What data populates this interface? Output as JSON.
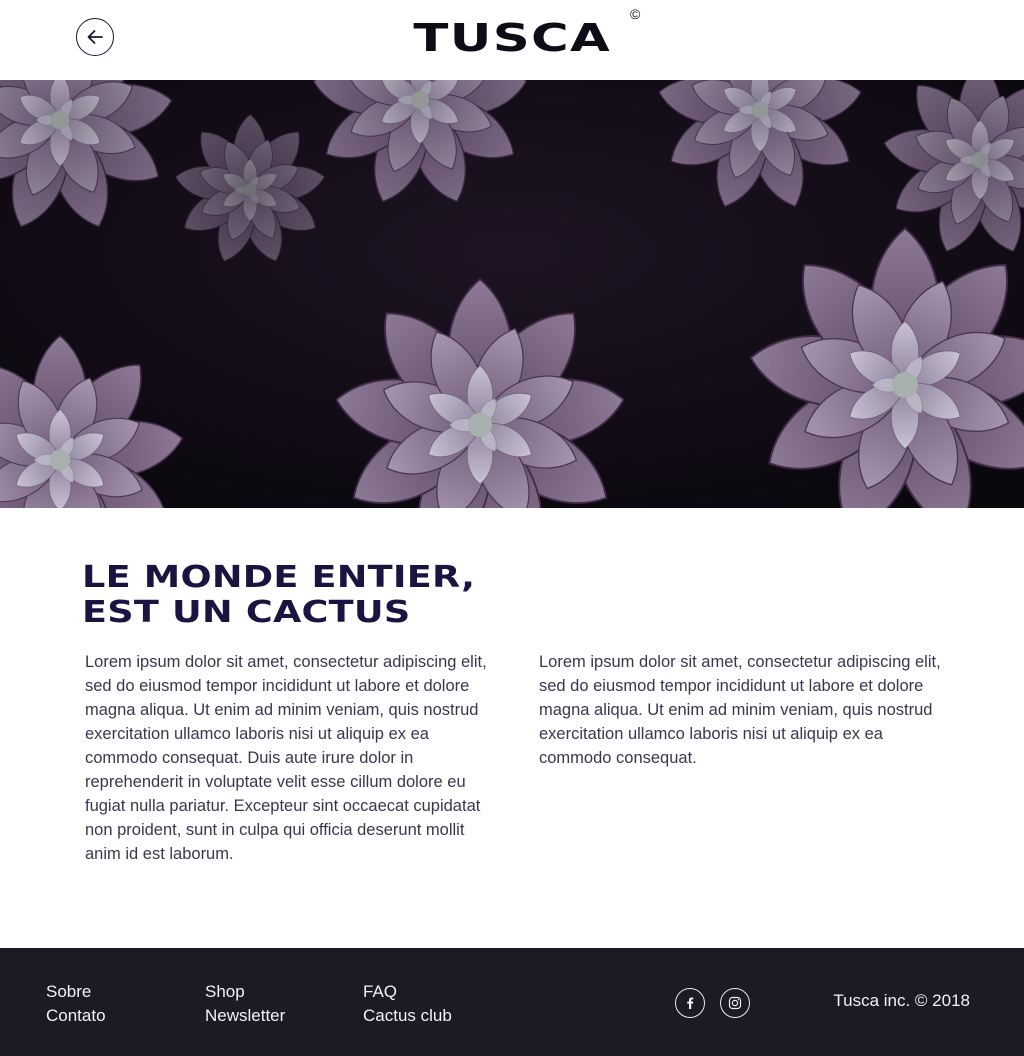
{
  "header": {
    "logo_text": "TUSCA",
    "logo_mark": "©",
    "back_icon": "arrow-left-icon"
  },
  "hero": {
    "image": "purple succulent plants"
  },
  "main": {
    "headline_line1": "LE MONDE ENTIER,",
    "headline_line2": "EST UN CACTUS",
    "paragraph_left": "Lorem ipsum dolor sit amet, consectetur adipiscing elit, sed do eiusmod tempor incididunt ut labore et dolore magna aliqua. Ut enim ad minim veniam, quis nostrud exercitation ullamco laboris nisi ut aliquip ex ea commodo consequat. Duis aute irure dolor in reprehenderit in voluptate velit esse cillum dolore eu fugiat nulla pariatur. Excepteur sint occaecat cupidatat non proident, sunt in culpa qui officia deserunt mollit anim id est laborum.",
    "paragraph_right": "Lorem ipsum dolor sit amet, consectetur adipiscing elit, sed do eiusmod tempor incididunt ut labore et dolore magna aliqua. Ut enim ad minim veniam, quis nostrud exercitation ullamco laboris nisi ut aliquip ex ea commodo consequat."
  },
  "footer": {
    "links": [
      "Sobre",
      "Contato",
      "Shop",
      "Newsletter",
      "FAQ",
      "Cactus club"
    ],
    "social_icons": [
      "facebook-icon",
      "instagram-icon"
    ],
    "copyright": "Tusca inc. © 2018"
  },
  "colors": {
    "headline": "#1a1540",
    "footer_bg": "#1c1a24",
    "text": "#3a364e"
  }
}
